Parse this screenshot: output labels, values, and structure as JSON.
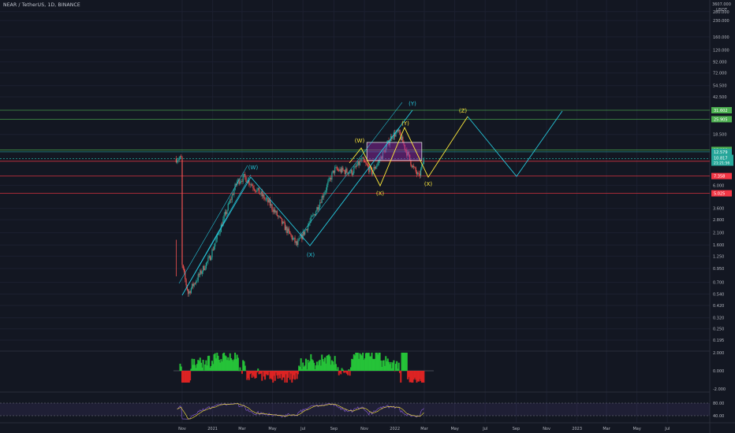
{
  "header": {
    "title": "NEAR / TetherUS, 1D, BINANCE"
  },
  "price_scale": {
    "currency_line1": "3607.000",
    "currency_line2": "USDT",
    "ticks": [
      "280.000",
      "230.000",
      "160.000",
      "120.000",
      "92.000",
      "72.000",
      "54.500",
      "42.500",
      "18.500",
      "6.000",
      "3.600",
      "2.800",
      "2.100",
      "1.600",
      "1.250",
      "0.950",
      "0.700",
      "0.540",
      "0.420",
      "0.320",
      "0.250",
      "0.195"
    ]
  },
  "horizontal_levels": [
    {
      "value": "31.602",
      "color": "#4caf50",
      "badge": "#4caf50"
    },
    {
      "value": "25.905",
      "color": "#4caf50",
      "badge": "#4caf50"
    },
    {
      "value": "13.129",
      "color": "#4caf50",
      "badge": "#4caf50"
    },
    {
      "value": "12.579",
      "color": "#26a69a",
      "badge": ""
    },
    {
      "value": "10.215",
      "color": "#f23645",
      "badge": "#f23645"
    },
    {
      "value": "7.358",
      "color": "#f23645",
      "badge": "#f23645"
    },
    {
      "value": "5.025",
      "color": "#f23645",
      "badge": "#f23645"
    }
  ],
  "current_price": {
    "value": "10.817",
    "countdown": "21:21:56",
    "color": "#26a69a"
  },
  "x_axis_ticks": [
    "Nov",
    "2021",
    "Mar",
    "May",
    "Jul",
    "Sep",
    "Nov",
    "2022",
    "Mar",
    "May",
    "Jul",
    "Sep",
    "Nov",
    "2023",
    "Mar",
    "May",
    "Jul"
  ],
  "wave_labels": [
    {
      "text": "(W)",
      "color": "#26c6da"
    },
    {
      "text": "(X)",
      "color": "#26c6da"
    },
    {
      "text": "(Y)",
      "color": "#26c6da"
    },
    {
      "text": "(W)",
      "color": "#ffeb3b"
    },
    {
      "text": "(X)",
      "color": "#ffeb3b"
    },
    {
      "text": "(Y)",
      "color": "#ffeb3b"
    },
    {
      "text": "(X)",
      "color": "#ffeb3b"
    },
    {
      "text": "(Z)",
      "color": "#ffeb3b"
    }
  ],
  "oscillator": {
    "ticks": [
      "2.000",
      "0.000",
      "-2.000"
    ]
  },
  "rsi": {
    "ticks": [
      "80.00",
      "40.00"
    ]
  },
  "colors": {
    "background": "#131722",
    "up": "#26a69a",
    "down": "#ef5350",
    "projection": "#ffeb3b",
    "projection2": "#26c6da",
    "box": "#9c27b0"
  },
  "chart_data": {
    "type": "line",
    "title": "NEAR / TetherUS, 1D, BINANCE",
    "y_scale": "log",
    "ylim": [
      0.16,
      400
    ],
    "x": [
      "Nov",
      "2021",
      "Mar",
      "May",
      "Jul",
      "Sep",
      "Nov",
      "2022",
      "Mar"
    ],
    "series": [
      {
        "values": [
          1.0,
          1.8,
          7.2,
          4.5,
          1.6,
          8.5,
          11.5,
          19.5,
          10.8
        ]
      }
    ]
  }
}
